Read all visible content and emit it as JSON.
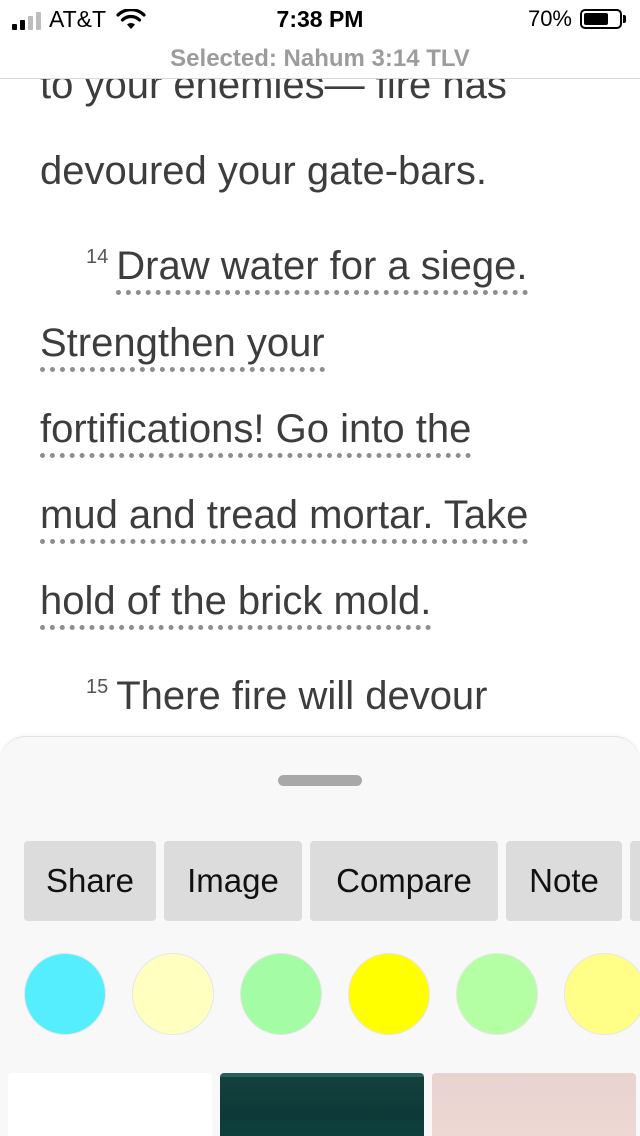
{
  "status_bar": {
    "carrier": "AT&T",
    "time": "7:38 PM",
    "battery_percent": "70%",
    "battery_level": 0.7,
    "signal_bars": 2
  },
  "header": {
    "selected_label": "Selected: Nahum 3:14 TLV"
  },
  "reader": {
    "lines": [
      "to your enemies— fire has",
      "devoured your gate-bars."
    ],
    "verse14": {
      "number": "14",
      "lines": [
        "Draw water for a siege.",
        "Strengthen your",
        "fortifications! Go into the",
        "mud and tread mortar. Take",
        "hold of the brick mold."
      ]
    },
    "verse15": {
      "number": "15",
      "line": "There fire will devour"
    }
  },
  "sheet": {
    "actions": [
      "Share",
      "Image",
      "Compare",
      "Note",
      ""
    ],
    "highlight_colors": [
      "#55eeff",
      "#ffffc0",
      "#a4fca4",
      "#ffff00",
      "#b4ffa4",
      "#ffff88"
    ],
    "image_thumbnails": [
      "white",
      "teal-texture",
      "pink-texture"
    ]
  }
}
